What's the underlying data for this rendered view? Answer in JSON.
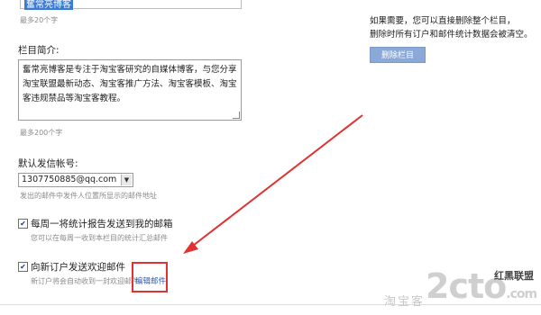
{
  "form": {
    "title_input_value": "奮常亮博客",
    "title_hint": "最多20个字",
    "desc_label": "栏目简介:",
    "desc_value": "奮常亮博客是专注于淘宝客研究的自媒体博客，与您分享淘宝联盟最新动态、淘宝客推广方法、淘宝客模板、淘宝客违规禁品等淘宝客教程。",
    "desc_hint": "最多200个字",
    "sender_label": "默认发信帐号:",
    "sender_value": "1307750885@qq.com",
    "sender_hint": "发出的邮件中发件人位置所显示的邮件地址",
    "weekly_label": "每周一将统计报告发送到我的邮箱",
    "weekly_hint": "您可以在每周一收到本栏目的统计汇总邮件",
    "weekly_checked": true,
    "welcome_label": "向新订户发送欢迎邮件",
    "welcome_hint": "新订户将会自动收到一封欢迎邮件",
    "welcome_checked": true,
    "edit_link": "编辑邮件"
  },
  "side": {
    "notice_line1": "如果需要，您可以直接删除整个栏目，",
    "notice_line2": "删除时所有订户和邮件统计数据会被清空。",
    "delete_button": "删除栏目"
  },
  "watermark": {
    "left_text": "淘宝客",
    "logo_text": "2cto",
    "logo_suffix": ".com",
    "brand_text": "红黑联盟"
  },
  "colors": {
    "arrow": "#e03232",
    "button": "#8aa9d8",
    "link": "#2b5bb8"
  }
}
